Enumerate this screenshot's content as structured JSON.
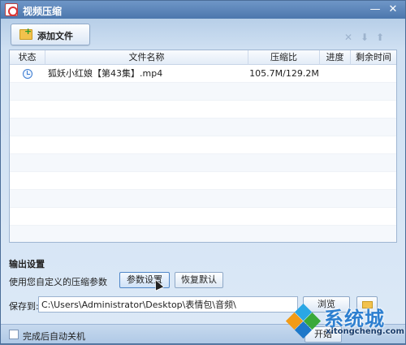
{
  "window": {
    "title": "视频压缩",
    "minimize": "—",
    "close": "✕"
  },
  "toolbar": {
    "add_file_label": "添加文件",
    "icons": [
      "close-icon",
      "arrow-down-icon",
      "arrow-up-icon"
    ]
  },
  "table": {
    "headers": [
      "状态",
      "文件名称",
      "压缩比",
      "进度",
      "剩余时间"
    ],
    "rows": [
      {
        "status_icon": "clock-icon",
        "file": "狐妖小红娘【第43集】.mp4",
        "ratio": "105.7M/129.2M",
        "progress": "",
        "remaining": ""
      }
    ]
  },
  "output": {
    "title": "输出设置",
    "custom_text": "使用您自定义的压缩参数",
    "params_button": "参数设置",
    "default_button": "恢复默认",
    "save_label": "保存到:",
    "save_path": "C:\\Users\\Administrator\\Desktop\\表情包\\音频\\",
    "browse_button": "浏览"
  },
  "status": {
    "shutdown_label": "完成后自动关机",
    "start_button": "开始"
  },
  "watermark": {
    "brand": "系统城",
    "url": "xitongcheng.com"
  },
  "colors": {
    "title_bar": "#4c77ad",
    "accent": "#2d7fd0",
    "folder": "#f2c24d"
  }
}
